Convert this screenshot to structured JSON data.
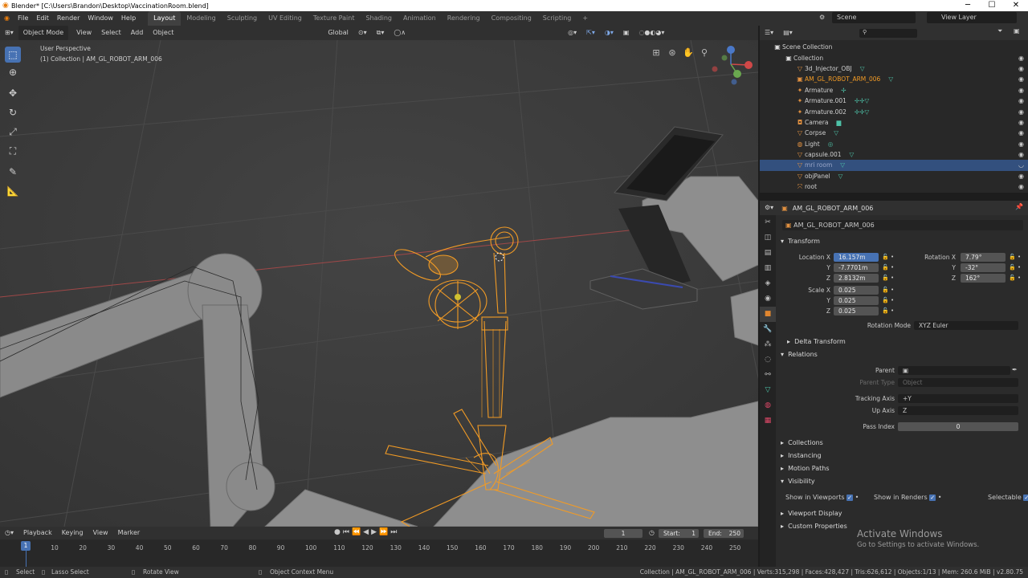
{
  "window": {
    "title": "Blender* [C:\\Users\\Brandon\\Desktop\\VaccinationRoom.blend]",
    "min": "─",
    "max": "☐",
    "close": "✕"
  },
  "menu": {
    "items": [
      "File",
      "Edit",
      "Render",
      "Window",
      "Help"
    ]
  },
  "workspaces": [
    "Layout",
    "Modeling",
    "Sculpting",
    "UV Editing",
    "Texture Paint",
    "Shading",
    "Animation",
    "Rendering",
    "Compositing",
    "Scripting",
    "+"
  ],
  "scene": {
    "label": "Scene",
    "view_layer": "View Layer"
  },
  "viewport_header": {
    "mode": "Object Mode",
    "menus": [
      "View",
      "Select",
      "Add",
      "Object"
    ],
    "orientation": "Global"
  },
  "viewport": {
    "perspective": "User Perspective",
    "collection": "(1) Collection | AM_GL_ROBOT_ARM_006"
  },
  "outliner": {
    "root": "Scene Collection",
    "collection": "Collection",
    "items": [
      "3d_Injector_OBJ",
      "AM_GL_ROBOT_ARM_006",
      "Armature",
      "Armature.001",
      "Armature.002",
      "Camera",
      "Corpse",
      "Light",
      "capsule.001",
      "mri room",
      "objPanel",
      "root"
    ],
    "selected": "mri room",
    "active": "AM_GL_ROBOT_ARM_006"
  },
  "properties": {
    "object_name": "AM_GL_ROBOT_ARM_006",
    "data_name": "AM_GL_ROBOT_ARM_006",
    "transform_title": "Transform",
    "location_label": "Location X",
    "y": "Y",
    "z": "Z",
    "location": [
      "16.157m",
      "-7.7701m",
      "2.8132m"
    ],
    "rotation_label": "Rotation X",
    "rotation": [
      "7.79°",
      "-32°",
      "162°"
    ],
    "scale_label": "Scale X",
    "scale": [
      "0.025",
      "0.025",
      "0.025"
    ],
    "rotation_mode_label": "Rotation Mode",
    "rotation_mode": "XYZ Euler",
    "delta": "Delta Transform",
    "relations": "Relations",
    "parent_label": "Parent",
    "parent_type_label": "Parent Type",
    "parent_type": "Object",
    "tracking_label": "Tracking Axis",
    "tracking": "+Y",
    "up_label": "Up Axis",
    "up": "Z",
    "pass_label": "Pass Index",
    "pass": "0",
    "collections": "Collections",
    "instancing": "Instancing",
    "motion_paths": "Motion Paths",
    "visibility": "Visibility",
    "show_viewports": "Show in Viewports",
    "show_renders": "Show in Renders",
    "selectable": "Selectable",
    "viewport_display": "Viewport Display",
    "custom_props": "Custom Properties"
  },
  "timeline": {
    "menus": [
      "Playback",
      "Keying",
      "View",
      "Marker"
    ],
    "current": "1",
    "start_label": "Start:",
    "start": "1",
    "end_label": "End:",
    "end": "250",
    "ticks": [
      "0",
      "10",
      "20",
      "30",
      "40",
      "50",
      "60",
      "70",
      "80",
      "90",
      "100",
      "110",
      "120",
      "130",
      "140",
      "150",
      "160",
      "170",
      "180",
      "190",
      "200",
      "210",
      "220",
      "230",
      "240",
      "250"
    ],
    "frame_marker": "1"
  },
  "statusbar": {
    "select": "Select",
    "lasso": "Lasso Select",
    "rotate": "Rotate View",
    "context": "Object Context Menu",
    "stats": "Collection | AM_GL_ROBOT_ARM_006 | Verts:315,298 | Faces:428,427 | Tris:626,612 | Objects:1/13 | Mem: 260.6 MiB | v2.80.75"
  },
  "watermark": {
    "title": "Activate Windows",
    "sub": "Go to Settings to activate Windows."
  },
  "colors": {
    "selection": "#f29b25",
    "accent": "#4772b3",
    "outliner_sel": "#33507e"
  }
}
